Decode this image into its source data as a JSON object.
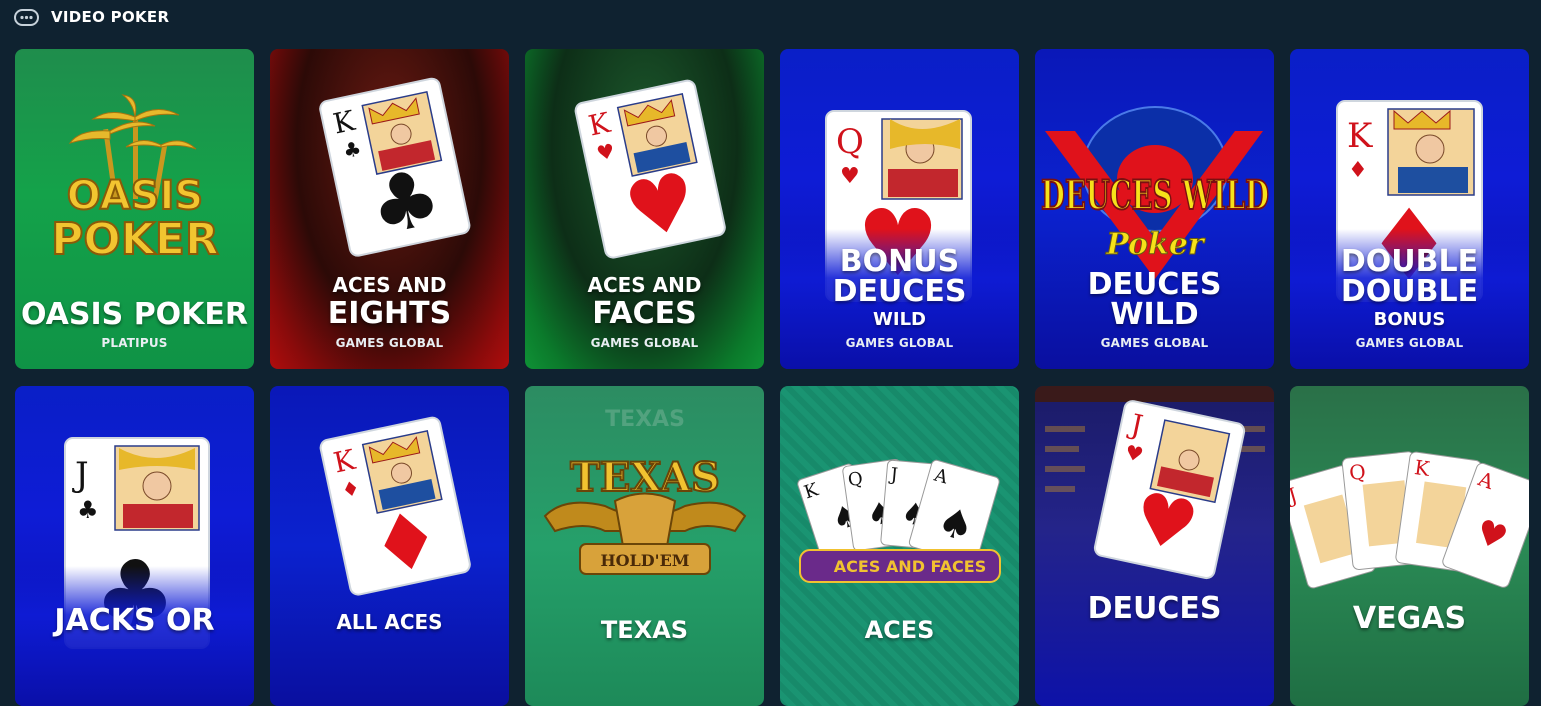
{
  "section": {
    "title": "VIDEO POKER",
    "icon": "gamepad-icon"
  },
  "games": [
    {
      "id": "oasis",
      "logo": "OASIS POKER",
      "title_lines": [
        "OASIS POKER"
      ],
      "provider": "PLATIPUS",
      "bg": "#14a24a"
    },
    {
      "id": "aces-eights",
      "card_rank": "K",
      "card_suit": "♣",
      "title_lines": [
        "ACES AND",
        "EIGHTS"
      ],
      "provider": "GAMES GLOBAL",
      "bg": "#8a0b0b"
    },
    {
      "id": "aces-faces",
      "card_rank": "K",
      "card_suit": "♥",
      "title_lines": [
        "ACES AND",
        "FACES"
      ],
      "provider": "GAMES GLOBAL",
      "bg": "#0b7a2b"
    },
    {
      "id": "bonus-deuces",
      "card_rank": "Q",
      "card_suit": "♥",
      "title_lines": [
        "BONUS",
        "DEUCES",
        "WILD"
      ],
      "provider": "GAMES GLOBAL",
      "bg": "#0e1cd6"
    },
    {
      "id": "deuces-wild",
      "logo": "DEUCES WILD",
      "logo_sub": "Poker",
      "title_lines": [
        "DEUCES",
        "WILD"
      ],
      "provider": "GAMES GLOBAL",
      "bg": "#0b22cf"
    },
    {
      "id": "double-double",
      "card_rank": "K",
      "card_suit": "♦",
      "title_lines": [
        "DOUBLE",
        "DOUBLE",
        "BONUS"
      ],
      "provider": "GAMES GLOBAL",
      "bg": "#0e1cd6"
    },
    {
      "id": "jacks-or",
      "card_rank": "J",
      "card_suit": "♣",
      "title_lines": [
        "JACKS OR"
      ],
      "bg": "#0e1cd6"
    },
    {
      "id": "all-aces",
      "card_rank": "K",
      "card_suit": "♦",
      "title_lines": [
        "ALL ACES"
      ],
      "bg": "#0b22cf"
    },
    {
      "id": "texas",
      "logo": "TEXAS",
      "logo_sub": "HOLD'EM",
      "title_lines": [
        "TEXAS"
      ],
      "bg": "#25a06a"
    },
    {
      "id": "aces",
      "logo": "ACES AND FACES",
      "cards": [
        "K",
        "Q",
        "J",
        "A"
      ],
      "title_lines": [
        "ACES"
      ],
      "bg": "#1a9472"
    },
    {
      "id": "deuces",
      "card_rank": "J",
      "card_suit": "♥",
      "title_lines": [
        "DEUCES"
      ],
      "bg": "#0d12a8"
    },
    {
      "id": "vegas",
      "cards": [
        "J",
        "Q",
        "K",
        "A"
      ],
      "title_lines": [
        "VEGAS"
      ],
      "bg": "#2a8a55"
    }
  ]
}
